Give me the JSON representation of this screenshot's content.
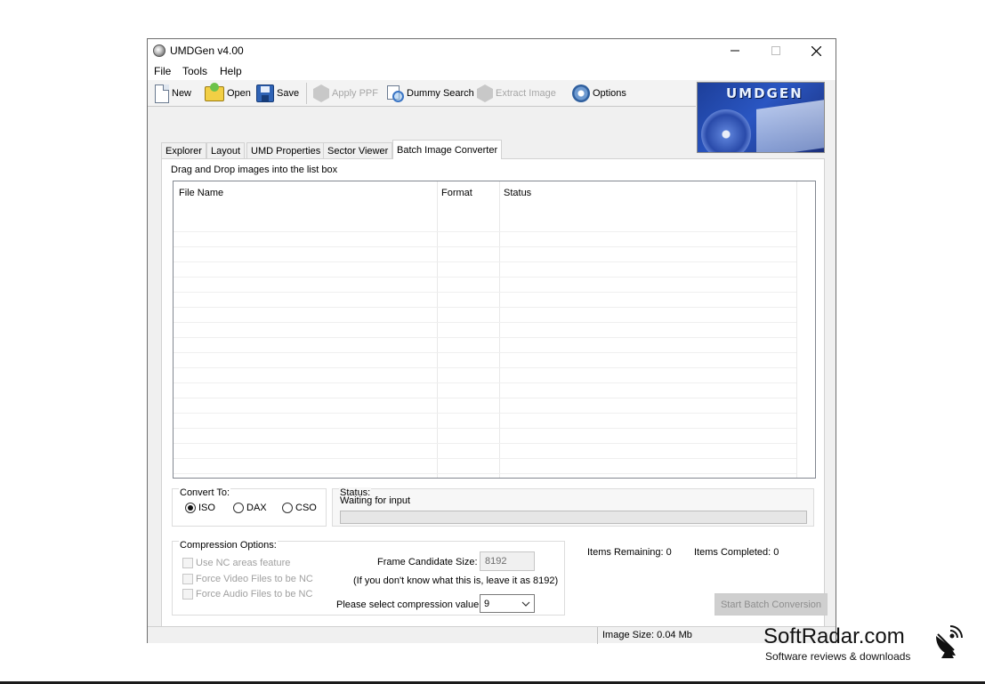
{
  "window": {
    "title": "UMDGen v4.00",
    "controls": {
      "minimize": "minimize-icon",
      "maximize": "maximize-icon",
      "close": "close-icon"
    }
  },
  "menu": [
    "File",
    "Tools",
    "Help"
  ],
  "toolbar": {
    "new": "New",
    "open": "Open",
    "save": "Save",
    "apply_ppf": "Apply PPF",
    "dummy_search": "Dummy Search",
    "extract_image": "Extract Image",
    "options": "Options"
  },
  "logo_text": "UMDGEN",
  "tabs": [
    "Explorer",
    "Layout",
    "UMD Properties",
    "Sector Viewer",
    "Batch Image Converter"
  ],
  "active_tab": "Batch Image Converter",
  "batch": {
    "instructions": "Drag and Drop images into the list box",
    "columns": [
      "File Name",
      "Format",
      "Status"
    ],
    "convert_to": {
      "title": "Convert To:",
      "options": [
        "ISO",
        "DAX",
        "CSO"
      ],
      "selected": "ISO"
    },
    "status": {
      "title": "Status:",
      "text": "Waiting for input",
      "progress": 0
    },
    "compression": {
      "title": "Compression Options:",
      "checkboxes": [
        "Use NC areas feature",
        "Force Video Files to be NC",
        "Force Audio Files to be NC"
      ],
      "frame_label": "Frame Candidate Size:",
      "frame_value": "8192",
      "frame_hint": "(If you don't know what this is, leave it as 8192)",
      "compression_label": "Please select compression value:",
      "compression_value": "9"
    },
    "items_remaining": "Items Remaining: 0",
    "items_completed": "Items Completed: 0",
    "start_button": "Start Batch Conversion"
  },
  "statusbar": {
    "image_size": "Image Size: 0.04 Mb"
  },
  "watermark": {
    "title": "SoftRadar.com",
    "subtitle": "Software reviews & downloads"
  },
  "colors": {
    "progress_fill": "#06b025",
    "logo_bg": "#1d3f9a",
    "window_bg": "#f0f0f0"
  }
}
